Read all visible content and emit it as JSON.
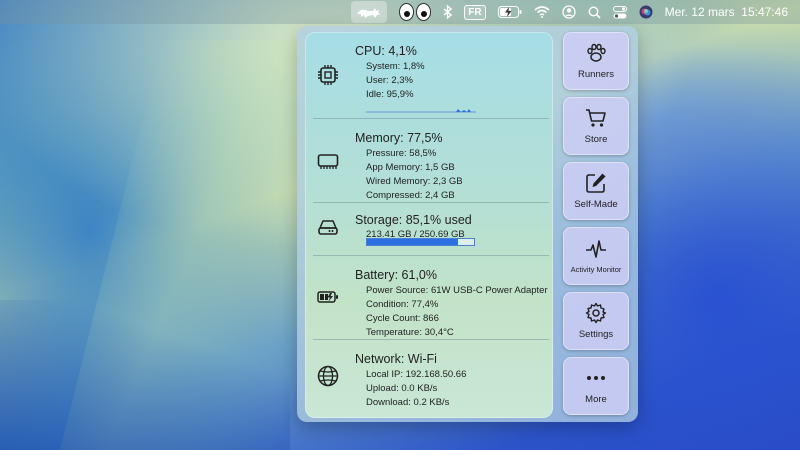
{
  "menubar": {
    "input_source": "FR",
    "datetime": "Mer. 12 mars  15:47:46",
    "icons": [
      "cat-app-icon",
      "eyes-icon",
      "bluetooth-icon",
      "input-source-icon",
      "battery-icon",
      "wifi-icon",
      "user-icon",
      "search-icon",
      "control-center-icon",
      "siri-icon"
    ]
  },
  "cpu": {
    "title": "CPU:  4,1%",
    "rows": [
      "System:  1,8%",
      "User:  2,3%",
      "Idle:  95,9%"
    ],
    "icon": "cpu-chip-icon"
  },
  "memory": {
    "title": "Memory: 77,5%",
    "rows": [
      "Pressure:  58,5%",
      "App Memory:  1,5 GB",
      "Wired Memory:  2,3 GB",
      "Compressed:  2,4 GB"
    ],
    "icon": "memory-icon"
  },
  "storage": {
    "title": "Storage: 85,1% used",
    "detail": "213.41 GB / 250.69 GB",
    "used_fraction": 0.851,
    "icon": "disk-icon"
  },
  "battery": {
    "title": "Battery:  61,0%",
    "rows": [
      "Power Source:  61W USB-C Power Adapter",
      "Condition:  77,4%",
      "Cycle Count:  866",
      "Temperature:  30,4°C"
    ],
    "icon": "battery-charging-icon"
  },
  "network": {
    "title": "Network: Wi-Fi",
    "rows": [
      "Local IP:  192.168.50.66",
      "Upload:  0.0 KB/s",
      "Download:  0.2 KB/s"
    ],
    "icon": "globe-icon"
  },
  "buttons": {
    "runners": "Runners",
    "store": "Store",
    "self_made": "Self-Made",
    "activity_monitor": "Activity Monitor",
    "settings": "Settings",
    "more": "More"
  }
}
